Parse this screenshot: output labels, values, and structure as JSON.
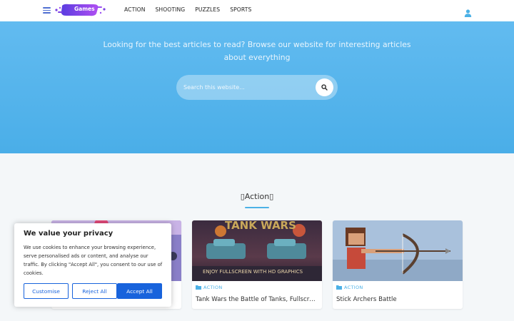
{
  "header": {
    "logo_text": "Games",
    "nav": [
      "ACTION",
      "SHOOTING",
      "PUZZLES",
      "SPORTS"
    ]
  },
  "hero": {
    "tagline": "Looking for the best articles to read? Browse our website for interesting articles about everything",
    "search_placeholder": "Search this website..."
  },
  "section": {
    "title": "▯Action▯"
  },
  "cards": [
    {
      "category": "",
      "title": ""
    },
    {
      "category": "ACTION",
      "title": "Tank Wars the Battle of Tanks, Fullscreen Game",
      "banner": "ENJOY FULLSCREEN WITH HD GRAPHICS",
      "logo": "TANK WARS"
    },
    {
      "category": "ACTION",
      "title": "Stick Archers Battle"
    }
  ],
  "cookie": {
    "title": "We value your privacy",
    "text": "We use cookies to enhance your browsing experience, serve personalised ads or content, and analyse our traffic. By clicking \"Accept All\", you consent to our use of cookies.",
    "customise": "Customise",
    "reject": "Reject All",
    "accept": "Accept All"
  },
  "colors": {
    "hero": "#55b4ec",
    "accent": "#4cb1e6",
    "cookie_button": "#1863dc",
    "logo": "#7b3fe4"
  }
}
